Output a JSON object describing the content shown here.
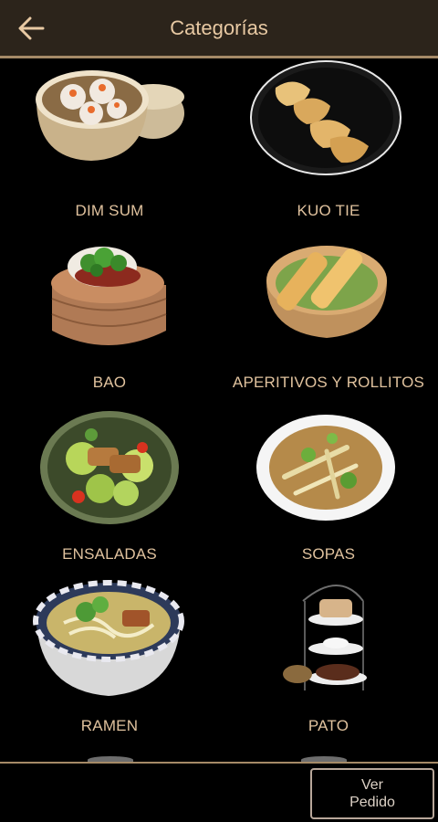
{
  "header": {
    "title": "Categorías",
    "back_icon": "arrow-left-icon"
  },
  "categories": [
    {
      "label": "DIM SUM",
      "icon": "dim-sum-image"
    },
    {
      "label": "KUO TIE",
      "icon": "kuo-tie-image"
    },
    {
      "label": "BAO",
      "icon": "bao-image"
    },
    {
      "label": "APERITIVOS Y ROLLITOS",
      "icon": "spring-rolls-image"
    },
    {
      "label": "ENSALADAS",
      "icon": "salad-image"
    },
    {
      "label": "SOPAS",
      "icon": "soup-image"
    },
    {
      "label": "RAMEN",
      "icon": "ramen-image"
    },
    {
      "label": "PATO",
      "icon": "duck-tower-image"
    }
  ],
  "footer": {
    "order_line1": "Ver",
    "order_line2": "Pedido"
  },
  "colors": {
    "header_bg": "#2c241b",
    "accent": "#a58a67",
    "label": "#e0c29e",
    "title": "#e8c9a3"
  }
}
